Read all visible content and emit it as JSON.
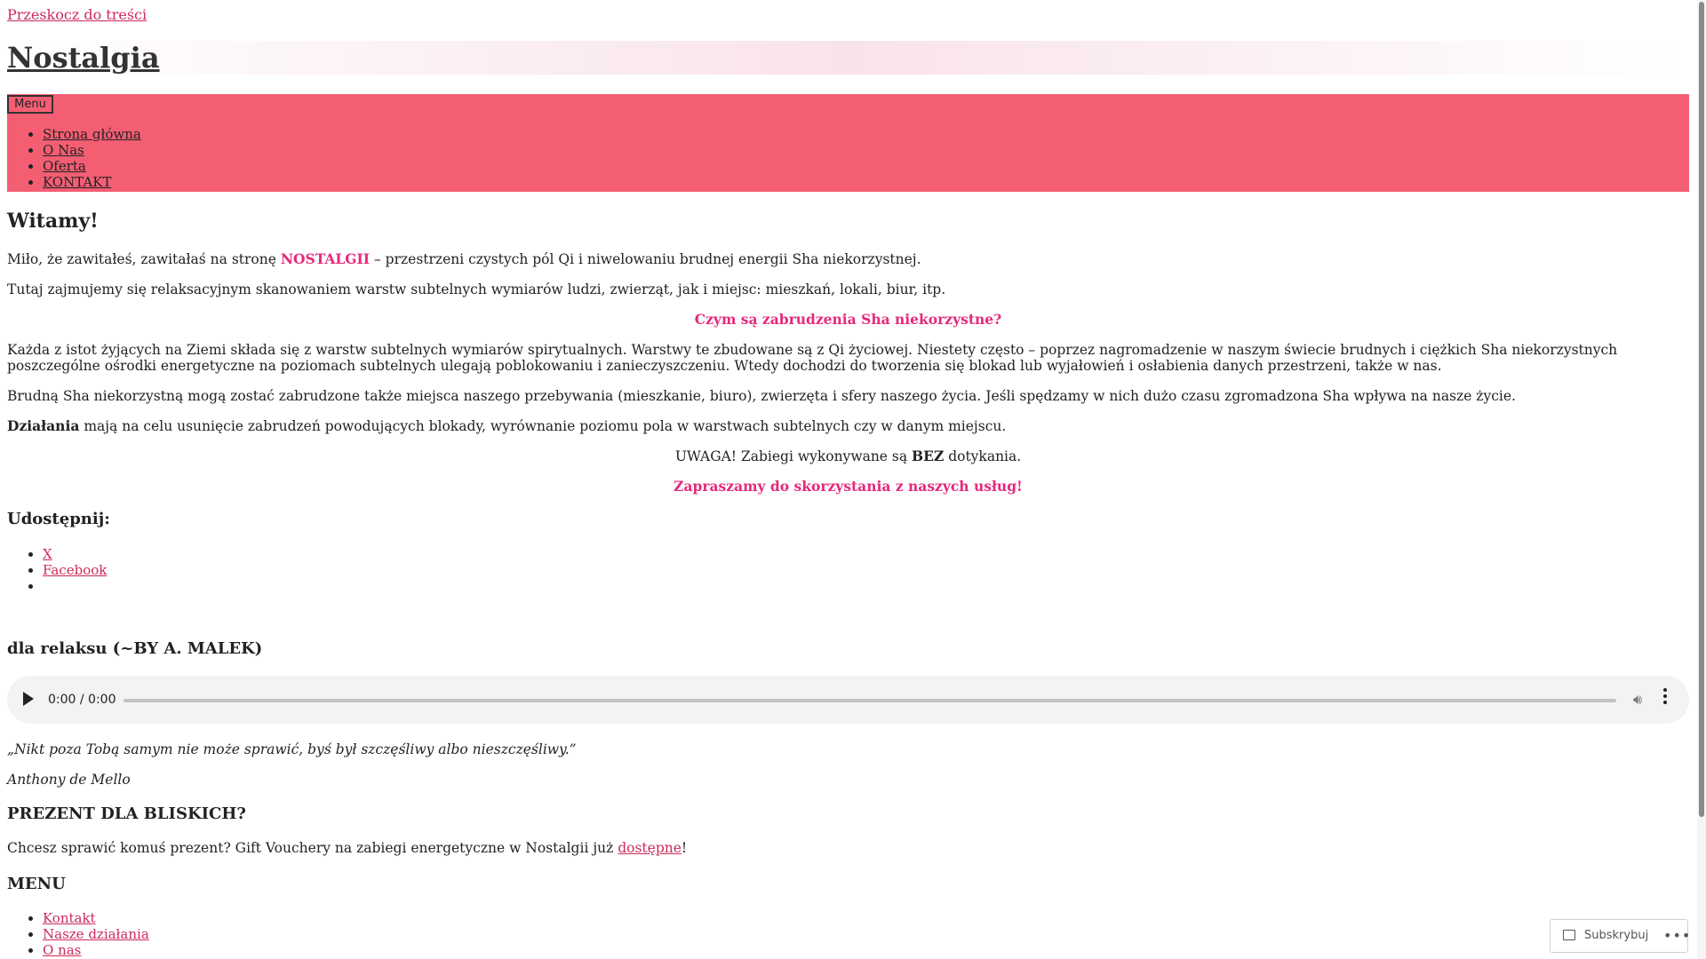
{
  "skip_link": "Przeskocz do treści",
  "site": {
    "title": "Nostalgia"
  },
  "nav": {
    "menu_button": "Menu",
    "items": [
      {
        "label": "Strona główna"
      },
      {
        "label": "O Nas"
      },
      {
        "label": "Oferta"
      },
      {
        "label": "KONTAKT"
      }
    ]
  },
  "colors": {
    "accent": "#f45e73",
    "highlight": "#e6297c",
    "link": "#cc2a5a"
  },
  "article": {
    "title": "Witamy!",
    "p1_pre": "Miło, że zawitałeś, zawitałaś na stronę ",
    "p1_brand": "NOSTALGII",
    "p1_post": " – przestrzeni czystych pól Qi i niwelowaniu brudnej energii Sha niekorzystnej.",
    "p2": "Tutaj zajmujemy się relaksacyjnym skanowaniem warstw subtelnych wymiarów ludzi, zwierząt, jak i miejsc: mieszkań, lokali, biur, itp.",
    "question": "Czym są zabrudzenia Sha niekorzystne?",
    "p3": "Każda z istot żyjących na Ziemi składa się z warstw subtelnych wymiarów spirytualnych. Warstwy te zbudowane są z  Qi życiowej. Niestety często – poprzez nagromadzenie w naszym świecie brudnych i ciężkich Sha niekorzystnych poszczególne ośrodki energetyczne na poziomach subtelnych ulegają poblokowaniu i zanieczyszczeniu. Wtedy dochodzi do tworzenia się blokad lub wyjałowień i osłabienia danych przestrzeni, także w nas.",
    "p4": "Brudną Sha niekorzystną mogą zostać zabrudzone także miejsca naszego przebywania (mieszkanie, biuro), zwierzęta i sfery naszego życia. Jeśli spędzamy w nich dużo czasu zgromadzona Sha wpływa na nasze życie.",
    "p5_bold": "Działania",
    "p5_rest": " mają na celu usunięcie zabrudzeń powodujących blokady, wyrównanie poziomu pola w warstwach subtelnych czy w danym miejscu.",
    "warning_pre": "UWAGA! Zabiegi wykonywane są ",
    "warning_bold": "BEZ",
    "warning_post": " dotykania.",
    "invite": "Zapraszamy do skorzystania z naszych usług!"
  },
  "share": {
    "title": "Udostępnij:",
    "items": [
      {
        "label": "X"
      },
      {
        "label": "Facebook"
      }
    ]
  },
  "relax_widget": {
    "title": "dla relaksu (~BY A. MALEK)",
    "time": "0:00 / 0:00"
  },
  "quote": {
    "text": "„Nikt poza Tobą samym nie może sprawić, byś był szczęśliwy albo nieszczęśliwy.”",
    "author": "Anthony de Mello"
  },
  "gift": {
    "title": "PREZENT DLA BLISKICH?",
    "text_pre": "Chcesz sprawić komuś prezent? Gift Vouchery na zabiegi energetyczne w Nostalgii już ",
    "link": "dostępne",
    "text_post": "!"
  },
  "footer_menu": {
    "title": "MENU",
    "items": [
      {
        "label": "Kontakt"
      },
      {
        "label": "Nasze działania"
      },
      {
        "label": "O nas"
      }
    ]
  },
  "subscribe": {
    "label": "Subskrybuj",
    "more": "•••"
  }
}
